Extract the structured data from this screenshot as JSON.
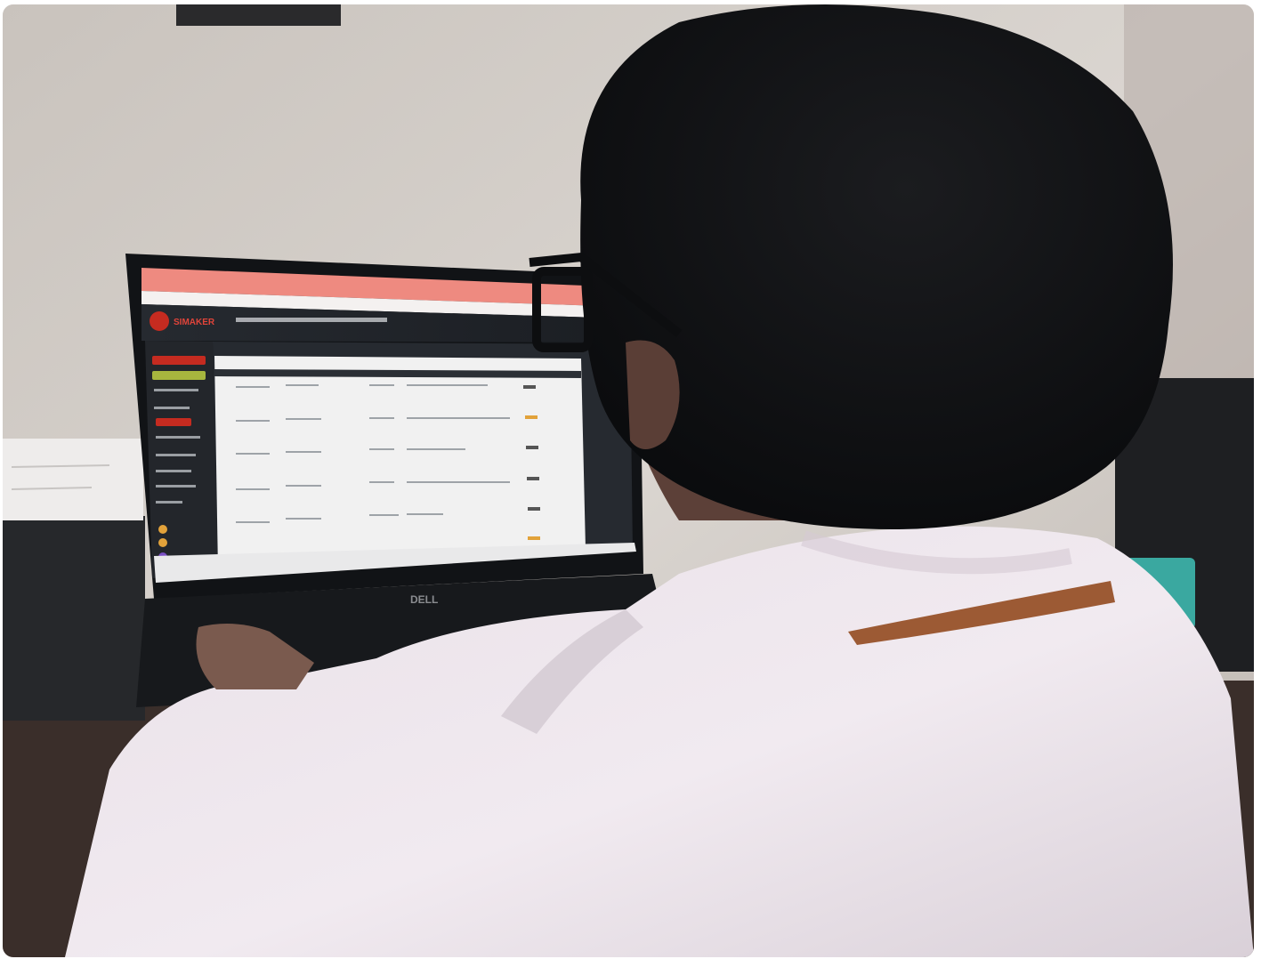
{
  "photo": {
    "type": "photo",
    "subject": "person-using-laptop",
    "colors": {
      "wall": "#d9d4cf",
      "hair": "#111214",
      "shirt": "#ede6ec",
      "laptop_bezel": "#111316",
      "app_header": "#1d2025",
      "app_sidebar": "#23262b",
      "app_table": "#f1f1f1",
      "browser_chrome": "#ee8a80",
      "accent_red": "#c52b20",
      "accent_green": "#a7b63e"
    },
    "laptop": {
      "brand_logo": "DELL",
      "screen": {
        "app_logo": "SIMAKER",
        "header_title": "",
        "icons": [
          "app-logo-icon",
          "sidebar-icons",
          "taskbar-icons"
        ]
      }
    }
  }
}
